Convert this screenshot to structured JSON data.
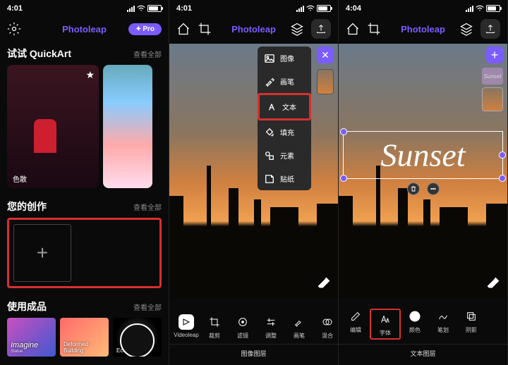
{
  "status": {
    "time_a": "4:01",
    "time_b": "4:01",
    "time_c": "4:04"
  },
  "app_title": "Photoleap",
  "pro_label": "Pro",
  "screen1": {
    "quickart_title": "试试 QuickArt",
    "see_all": "查看全部",
    "card_label": "色散",
    "creations_title": "您的创作",
    "templates_title": "使用成品",
    "tpl1": "Imagine",
    "tpl1_sub": "Statue",
    "tpl2": "Deformed Building",
    "tpl3": "Eclipse"
  },
  "screen2": {
    "menu": {
      "image": "图像",
      "brush": "画笔",
      "text": "文本",
      "fill": "填充",
      "element": "元素",
      "sticker": "贴纸"
    },
    "tools": {
      "videoleap": "Videoleap",
      "crop": "裁剪",
      "filter": "滤镜",
      "adjust": "调整",
      "brush": "画笔",
      "blend": "混合"
    },
    "layer_label": "图像图层"
  },
  "screen3": {
    "preview_text": "Sunset",
    "text_content": "Sunset",
    "tools": {
      "edit": "编辑",
      "font": "字体",
      "color": "颜色",
      "stroke": "笔划",
      "shadow": "阴影"
    },
    "layer_label": "文本图层"
  }
}
